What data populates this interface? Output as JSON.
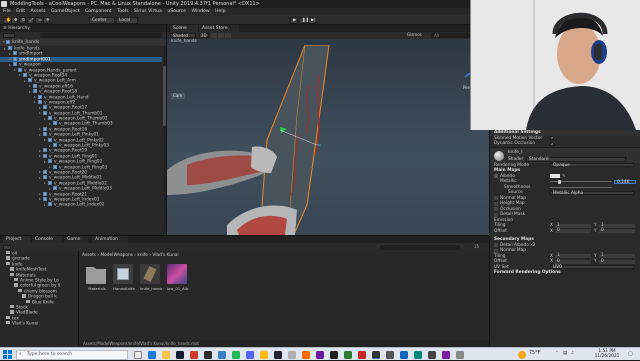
{
  "window": {
    "title": "ModdingTools - aCoolWeapons - PC, Mac & Linux Standalone - Unity 2019.4.37f1 Personal* <DX11>"
  },
  "menu": [
    "File",
    "Edit",
    "Assets",
    "GameObject",
    "Component",
    "Tools",
    "Sirius Virtua",
    "uSource",
    "Window",
    "Help"
  ],
  "toolbar": {
    "center_label": "Center",
    "local_label": "Local"
  },
  "hierarchy": {
    "tab_label": "Hierarchy",
    "breadcrumb_label": "knife_hands",
    "rows": [
      {
        "label": "knife_hands",
        "indent": 0,
        "selected": false
      },
      {
        "label": "smdImport",
        "indent": 1,
        "selected": false
      },
      {
        "label": "smdImport001",
        "indent": 1,
        "selected": true
      },
      {
        "label": "v_weapon",
        "indent": 1,
        "selected": false
      },
      {
        "label": "v_weapon.Hands_parent",
        "indent": 2,
        "selected": false
      },
      {
        "label": "v_weapon.Root34",
        "indent": 3,
        "selected": false
      },
      {
        "label": "v_weapon.Left_Arm",
        "indent": 4,
        "selected": false
      },
      {
        "label": "v_weapon.eff16",
        "indent": 5,
        "selected": false
      },
      {
        "label": "v_weapon.Root18",
        "indent": 5,
        "selected": false
      },
      {
        "label": "v_weapon.Left_Hand",
        "indent": 6,
        "selected": false
      },
      {
        "label": "v_weapon.eff2",
        "indent": 6,
        "selected": false
      },
      {
        "label": "v_weapon.Root17",
        "indent": 7,
        "selected": false
      },
      {
        "label": "v_weapon.Left_Thumb01",
        "indent": 7,
        "selected": false
      },
      {
        "label": "v_weapon.Left_Thumb02",
        "indent": 8,
        "selected": false
      },
      {
        "label": "v_weapon.Left_Thumb03",
        "indent": 9,
        "selected": false
      },
      {
        "label": "v_weapon.Root16",
        "indent": 7,
        "selected": false
      },
      {
        "label": "v_weapon.Left_Pinky01",
        "indent": 7,
        "selected": false
      },
      {
        "label": "v_weapon.Left_Pinky02",
        "indent": 8,
        "selected": false
      },
      {
        "label": "v_weapon.Left_Pinky03",
        "indent": 9,
        "selected": false
      },
      {
        "label": "v_weapon.Root19",
        "indent": 7,
        "selected": false
      },
      {
        "label": "v_weapon.Left_Ring01",
        "indent": 7,
        "selected": false
      },
      {
        "label": "v_weapon.Left_Ring02",
        "indent": 8,
        "selected": false
      },
      {
        "label": "v_weapon.Left_Ring03",
        "indent": 9,
        "selected": false
      },
      {
        "label": "v_weapon.Root20",
        "indent": 7,
        "selected": false
      },
      {
        "label": "v_weapon.Left_Middle01",
        "indent": 7,
        "selected": false
      },
      {
        "label": "v_weapon.Left_Middle02",
        "indent": 8,
        "selected": false
      },
      {
        "label": "v_weapon.Left_Middle03",
        "indent": 9,
        "selected": false
      },
      {
        "label": "v_weapon.Root21",
        "indent": 7,
        "selected": false
      },
      {
        "label": "v_weapon.Left_Index01",
        "indent": 7,
        "selected": false
      },
      {
        "label": "v_weapon.Left_Index02",
        "indent": 8,
        "selected": false
      }
    ]
  },
  "scene": {
    "tabs": [
      "Scene",
      "Asset Store"
    ],
    "breadcrumb": "knife_hands",
    "shading_mode": "Shaded",
    "dim_label": "2D",
    "gizmos_label": "Gizmos",
    "search_placeholder": "All",
    "camera_label": "Cam",
    "persp_label": "Persp"
  },
  "project": {
    "tabs": [
      "Project",
      "Console",
      "Game",
      "Animation"
    ],
    "search_placeholder": "",
    "count_label": "15",
    "breadcrumb": [
      "Assets",
      "ModelWeapons",
      "knife",
      "Vlad's Kunai"
    ],
    "tree": [
      {
        "label": "c4",
        "indent": 1
      },
      {
        "label": "grenade",
        "indent": 1
      },
      {
        "label": "knife",
        "indent": 1
      },
      {
        "label": "knifeMeshTest",
        "indent": 2
      },
      {
        "label": "Materials",
        "indent": 2
      },
      {
        "label": "Anime Style by Lo",
        "indent": 3
      },
      {
        "label": "colorful green by ll",
        "indent": 3
      },
      {
        "label": "cherry blossom",
        "indent": 4
      },
      {
        "label": "Dragon ball k",
        "indent": 5
      },
      {
        "label": "Blue Knife",
        "indent": 6
      },
      {
        "label": "Stock",
        "indent": 2
      },
      {
        "label": "VladBlade",
        "indent": 2
      },
      {
        "label": "tex",
        "indent": 1
      },
      {
        "label": "Vlad's Kunai",
        "indent": 1
      }
    ],
    "assets": [
      {
        "label": "Materials",
        "kind": "folder"
      },
      {
        "label": "HandsKnife",
        "kind": "prefab"
      },
      {
        "label": "knife_hands",
        "kind": "model"
      },
      {
        "label": "low_01_Alb...",
        "kind": "texture"
      }
    ],
    "footer_path": "Assets/ModelWeapons/knife/Vlad's Kunai/knife_hands.mat"
  },
  "inspector": {
    "section_additional": "Additional Settings",
    "skinned_motion_label": "Skinned Motion Vector",
    "dynamic_occlusion_label": "Dynamic Occlusion",
    "material_name": "knife_l",
    "shader_label": "Shader",
    "shader_value": "Standard",
    "rendering_mode_label": "Rendering Mode",
    "rendering_mode_value": "Opaque",
    "main_maps_label": "Main Maps",
    "albedo_label": "Albedo",
    "metallic_label": "Metallic",
    "metallic_value": "0.146",
    "metallic_fraction": 0.146,
    "smoothness_label": "Smoothness",
    "source_label": "Source",
    "source_value": "Metallic Alpha",
    "normal_map_label": "Normal Map",
    "height_map_label": "Height Map",
    "occlusion_label": "Occlusion",
    "detail_mask_label": "Detail Mask",
    "emission_label": "Emission",
    "tiling_label": "Tiling",
    "offset_label": "Offset",
    "x_label": "X",
    "y_label": "Y",
    "tiling_x": "1",
    "tiling_y": "1",
    "offset_x": "0",
    "offset_y": "0",
    "secondary_maps_label": "Secondary Maps",
    "detail_albedo_label": "Detail Albedo x2",
    "uv_set_label": "UV Set",
    "uv_set_value": "UV0",
    "forward_rendering_label": "Forward Rendering Options"
  },
  "taskbar": {
    "search_placeholder": "Type here to search",
    "weather": "75°F",
    "time": "1:51 PM",
    "date": "11/26/2021"
  },
  "colors": {
    "selection": "#2c5d87",
    "unity_dark": "#282828",
    "blade_outline": "#e58b2a",
    "blood": "#a82a22"
  }
}
